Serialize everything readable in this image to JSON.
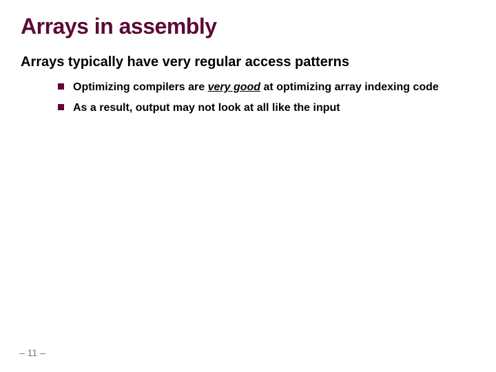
{
  "title": "Arrays in assembly",
  "subhead": "Arrays typically have very regular access patterns",
  "bullets": [
    {
      "pre": "Optimizing compilers are ",
      "emph": "very good",
      "post": " at optimizing array indexing code"
    },
    {
      "pre": "As a result, output may not look at all like the input",
      "emph": "",
      "post": ""
    }
  ],
  "page": "– 11 –"
}
